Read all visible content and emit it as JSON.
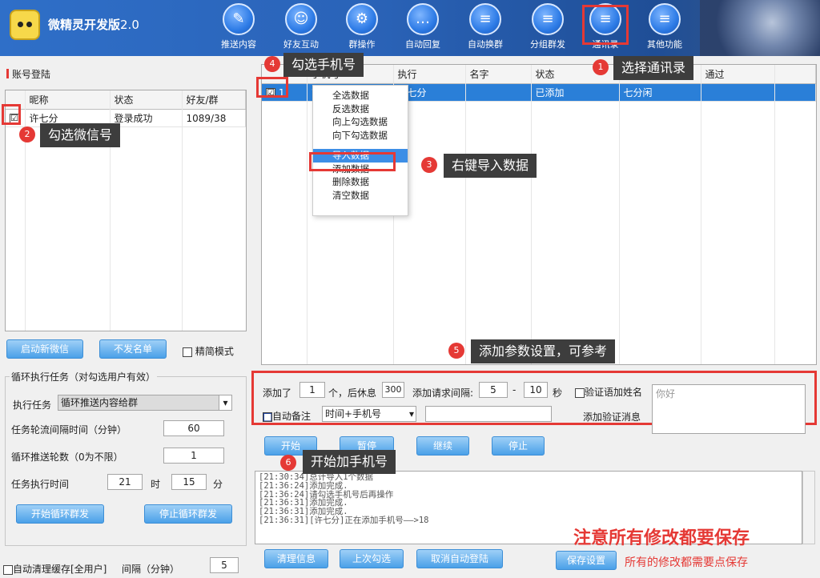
{
  "app": {
    "title": "微精灵开发版",
    "version": "2.0"
  },
  "nav": [
    {
      "label": "推送内容",
      "icon": "pen-icon",
      "glyph": "✎"
    },
    {
      "label": "好友互动",
      "icon": "friends-icon",
      "glyph": "☺"
    },
    {
      "label": "群操作",
      "icon": "gear-icon",
      "glyph": "⚙"
    },
    {
      "label": "自动回复",
      "icon": "chat-icon",
      "glyph": "…"
    },
    {
      "label": "自动换群",
      "icon": "chat-icon",
      "glyph": "≡"
    },
    {
      "label": "分组群发",
      "icon": "chat-icon",
      "glyph": "≡"
    },
    {
      "label": "通讯录",
      "icon": "contacts-icon",
      "glyph": "≡"
    },
    {
      "label": "其他功能",
      "icon": "chat-icon",
      "glyph": "≡"
    }
  ],
  "account": {
    "section_title": "账号登陆",
    "columns": [
      "昵称",
      "状态",
      "好友/群"
    ],
    "rows": [
      {
        "checked": "☑",
        "nickname": "许七分",
        "status": "登录成功",
        "counts": "1089/38"
      }
    ]
  },
  "left_buttons": {
    "new_wechat": "启动新微信",
    "no_send_list": "不发名单",
    "compact_mode": "精简模式"
  },
  "loop": {
    "title": "循环执行任务（对勾选用户有效）",
    "exec_task_label": "执行任务",
    "exec_task_value": "循环推送内容给群",
    "interval_label": "任务轮流间隔时间（分钟）",
    "interval_value": "60",
    "rounds_label": "循环推送轮数（0为不限）",
    "rounds_value": "1",
    "time_label": "任务执行时间",
    "hour_value": "21",
    "hour_unit": "时",
    "minute_value": "15",
    "minute_unit": "分",
    "start_button": "开始循环群发",
    "stop_button": "停止循环群发"
  },
  "cache": {
    "label": "自动清理缓存[全用户]",
    "interval_label": "间隔（分钟）",
    "interval_value": "5"
  },
  "contacts_table": {
    "columns": [
      "手机号",
      "执行",
      "名字",
      "状态",
      "返回",
      "通过"
    ],
    "rows": [
      {
        "checked": "☑",
        "index": "1",
        "phone": "1",
        "exec": "许七分",
        "name": "",
        "status": "已添加",
        "result": "七分闲",
        "pass": ""
      }
    ]
  },
  "context_menu": {
    "items_top": [
      "全选数据",
      "反选数据",
      "向上勾选数据",
      "向下勾选数据"
    ],
    "highlighted": "导入数据",
    "items_bottom": [
      "添加数据",
      "删除数据",
      "清空数据"
    ]
  },
  "params": {
    "added_label": "添加了",
    "added_value": "1",
    "rest_label": "个，后休息",
    "rest_value": "300",
    "interval_label": "添加请求间隔:",
    "interval_min": "5",
    "dash": "-",
    "interval_max": "10",
    "sec_label": "秒",
    "verify_name_label": "验证语加姓名",
    "auto_remark_label": "自动备注",
    "remark_option": "时间+手机号",
    "remark_text": "",
    "verify_msg_label": "添加验证消息",
    "verify_msg_value": "你好"
  },
  "controls": {
    "start": "开始",
    "pause": "暂停",
    "resume": "继续",
    "stop": "停止"
  },
  "log_lines": [
    "[21:30:34]总计导入1个数据",
    "[21:36:24]添加完成.",
    "[21:36:24]请勾选手机号后再操作",
    "[21:36:31]添加完成.",
    "[21:36:31]添加完成.",
    "[21:36:31][许七分]正在添加手机号——>18"
  ],
  "bottom_buttons": {
    "clear_info": "清理信息",
    "last_check": "上次勾选",
    "cancel_auto_login": "取消自动登陆",
    "save_settings": "保存设置"
  },
  "notes": {
    "big": "注意所有修改都要保存",
    "small": "所有的修改都需要点保存"
  },
  "callouts": [
    {
      "num": "1",
      "text": "选择通讯录"
    },
    {
      "num": "2",
      "text": "勾选微信号"
    },
    {
      "num": "3",
      "text": "右键导入数据"
    },
    {
      "num": "4",
      "text": "勾选手机号"
    },
    {
      "num": "5",
      "text": "添加参数设置，可参考"
    },
    {
      "num": "6",
      "text": "开始加手机号"
    }
  ],
  "colors": {
    "accent_red": "#e53935",
    "header_blue": "#2f6fc8",
    "button_blue": "#4aa0e8",
    "selection_blue": "#2a7fd8"
  }
}
